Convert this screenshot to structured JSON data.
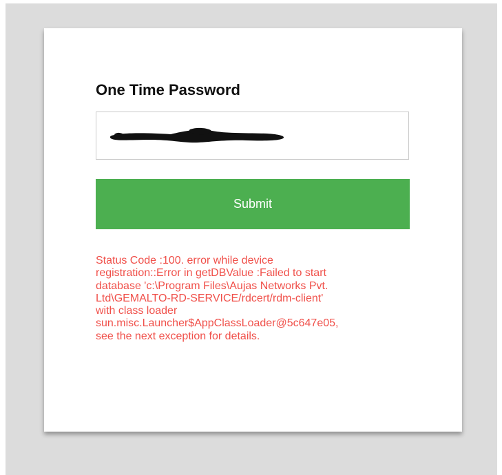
{
  "form": {
    "title": "One Time Password",
    "otp_value": "",
    "submit_label": "Submit"
  },
  "status": {
    "error_message": "Status Code :100. error while device\nregistration::Error in getDBValue :Failed to start\ndatabase 'c:\\Program Files\\Aujas Networks Pvt.\nLtd\\GEMALTO-RD-SERVICE/rdcert/rdm-client'\nwith class loader\nsun.misc.Launcher$AppClassLoader@5c647e05,\nsee the next exception for details."
  },
  "colors": {
    "background": "#dcdcdc",
    "card": "#ffffff",
    "submit_button": "#4caf50",
    "error_text": "#f0504a"
  }
}
